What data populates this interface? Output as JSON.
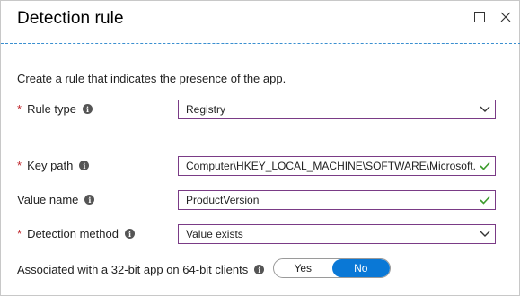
{
  "header": {
    "title": "Detection rule"
  },
  "description": "Create a rule that indicates the presence of the app.",
  "fields": {
    "rule_type": {
      "label": "Rule type",
      "value": "Registry"
    },
    "key_path": {
      "label": "Key path",
      "value": "Computer\\HKEY_LOCAL_MACHINE\\SOFTWARE\\Microsoft..."
    },
    "value_name": {
      "label": "Value name",
      "value": "ProductVersion"
    },
    "detection_method": {
      "label": "Detection method",
      "value": "Value exists"
    },
    "associated_32bit": {
      "label": "Associated with a 32-bit app on 64-bit clients",
      "yes": "Yes",
      "no": "No",
      "selected": "No"
    }
  },
  "icons": {
    "maximize": "maximize-icon",
    "close": "close-icon",
    "info": "info-icon",
    "chevron": "chevron-down-icon",
    "check": "check-icon"
  },
  "colors": {
    "accent": "#0a78d6",
    "required": "#c0272d",
    "field_border": "#7a3b86",
    "valid_check": "#3c9b2c"
  }
}
